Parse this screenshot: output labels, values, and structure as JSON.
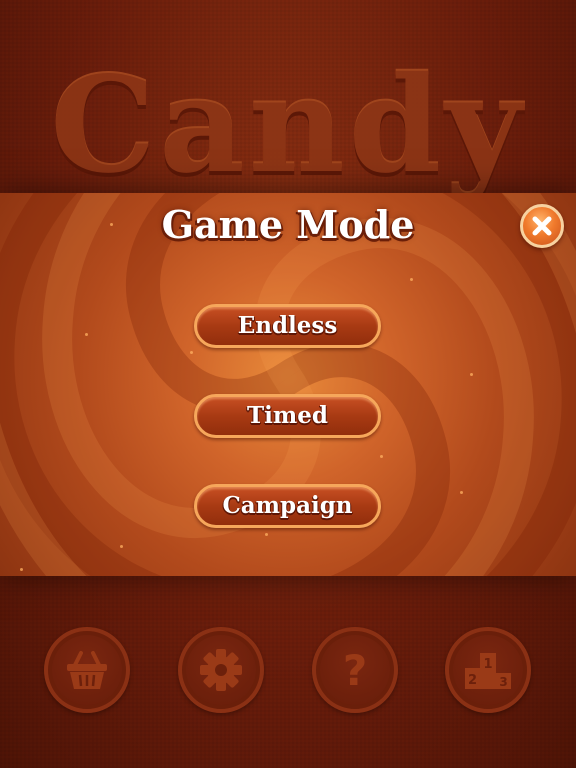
{
  "background": {
    "logo_text": "Candy"
  },
  "dialog": {
    "title": "Game Mode",
    "close_icon": "close-x-icon",
    "buttons": [
      {
        "label": "Endless"
      },
      {
        "label": "Timed"
      },
      {
        "label": "Campaign"
      }
    ]
  },
  "bottom_bar": {
    "icons": [
      "shop-basket-icon",
      "settings-gear-icon",
      "help-question-icon",
      "leaderboard-podium-icon"
    ],
    "podium_numbers": [
      "1",
      "2",
      "3"
    ],
    "help_glyph": "?"
  },
  "colors": {
    "accent_orange": "#f07a2c",
    "button_fill": "#a83a13",
    "button_border": "#f6a75b",
    "background_dark": "#6b1d0b"
  }
}
